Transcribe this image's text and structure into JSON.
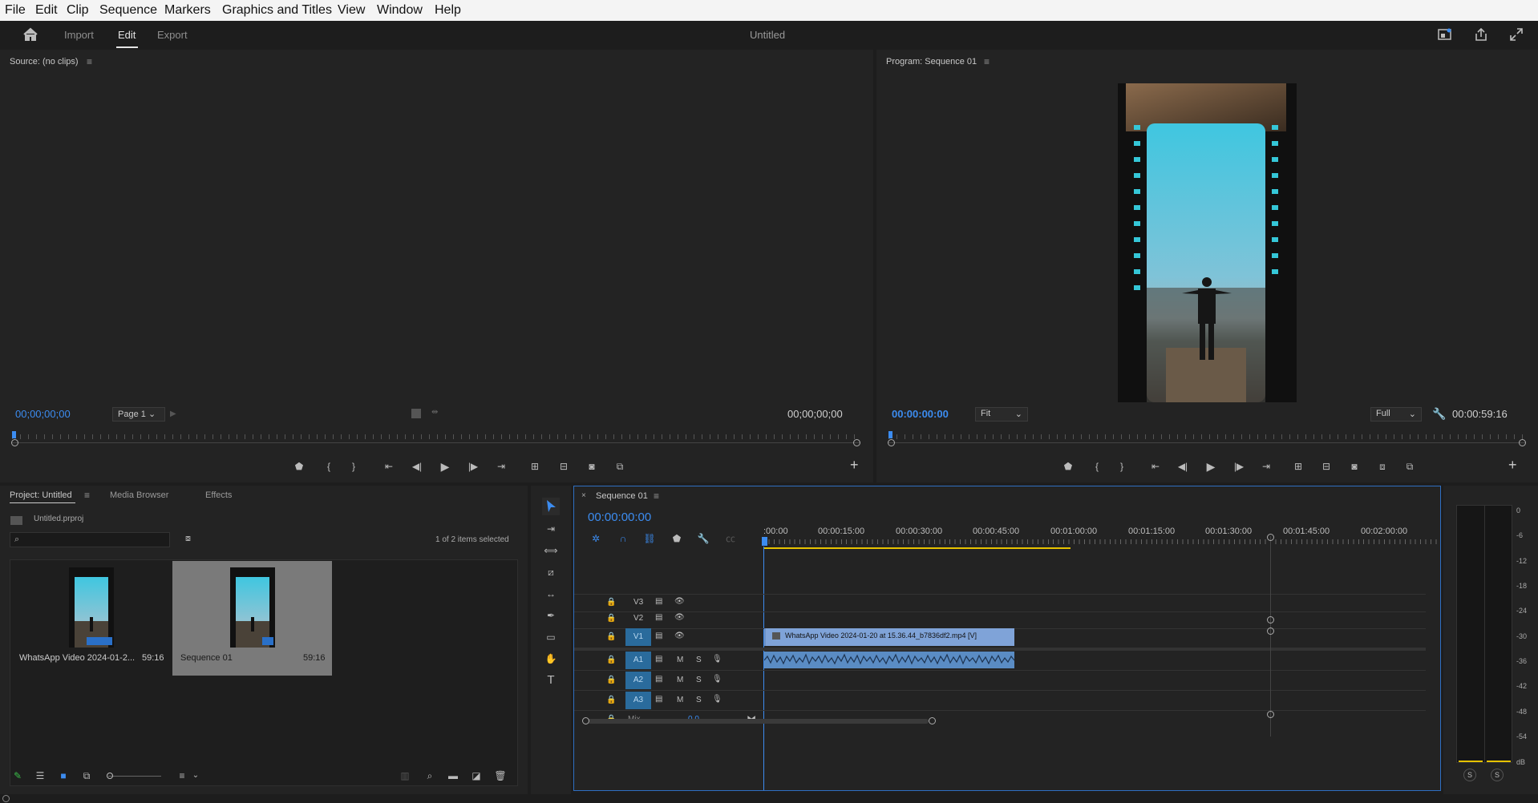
{
  "menu": [
    "File",
    "Edit",
    "Clip",
    "Sequence",
    "Markers",
    "Graphics and Titles",
    "View",
    "Window",
    "Help"
  ],
  "header": {
    "tabs": [
      "Import",
      "Edit",
      "Export"
    ],
    "active_tab": "Edit",
    "title": "Untitled"
  },
  "source": {
    "title": "Source: (no clips)",
    "timecode_in": "00;00;00;00",
    "page": "Page 1",
    "timecode_out": "00;00;00;00"
  },
  "program": {
    "title": "Program: Sequence 01",
    "timecode": "00:00:00:00",
    "zoom": "Fit",
    "quality": "Full",
    "duration": "00:00:59:16"
  },
  "project": {
    "tabs": [
      "Project: Untitled",
      "Media Browser",
      "Effects"
    ],
    "file": "Untitled.prproj",
    "search_placeholder": "",
    "selection": "1 of 2 items selected",
    "items": [
      {
        "name": "WhatsApp Video 2024-01-2...",
        "duration": "59:16"
      },
      {
        "name": "Sequence 01",
        "duration": "59:16"
      }
    ]
  },
  "timeline": {
    "tab": "Sequence 01",
    "timecode": "00:00:00:00",
    "ruler": [
      ":00:00",
      "00:00:15:00",
      "00:00:30:00",
      "00:00:45:00",
      "00:01:00:00",
      "00:01:15:00",
      "00:01:30:00",
      "00:01:45:00",
      "00:02:00:00"
    ],
    "video_tracks": [
      "V3",
      "V2",
      "V1"
    ],
    "audio_tracks": [
      "A1",
      "A2",
      "A3"
    ],
    "mix_label": "Mix",
    "mix_value": "0.0",
    "clip_label": "WhatsApp Video 2024-01-20 at 15.36.44_b7836df2.mp4 [V]",
    "mute": "M",
    "solo": "S"
  },
  "meter": {
    "scale": [
      "0",
      "-6",
      "-12",
      "-18",
      "-24",
      "-30",
      "-36",
      "-42",
      "-48",
      "-54",
      "dB"
    ],
    "solo": [
      "S",
      "S"
    ]
  },
  "colors": {
    "accent": "#3c8cf0",
    "clip_video": "#7fa3d8",
    "clip_audio": "#5a8cc4",
    "target": "#2a6b9c",
    "work_area": "#e6c200"
  }
}
